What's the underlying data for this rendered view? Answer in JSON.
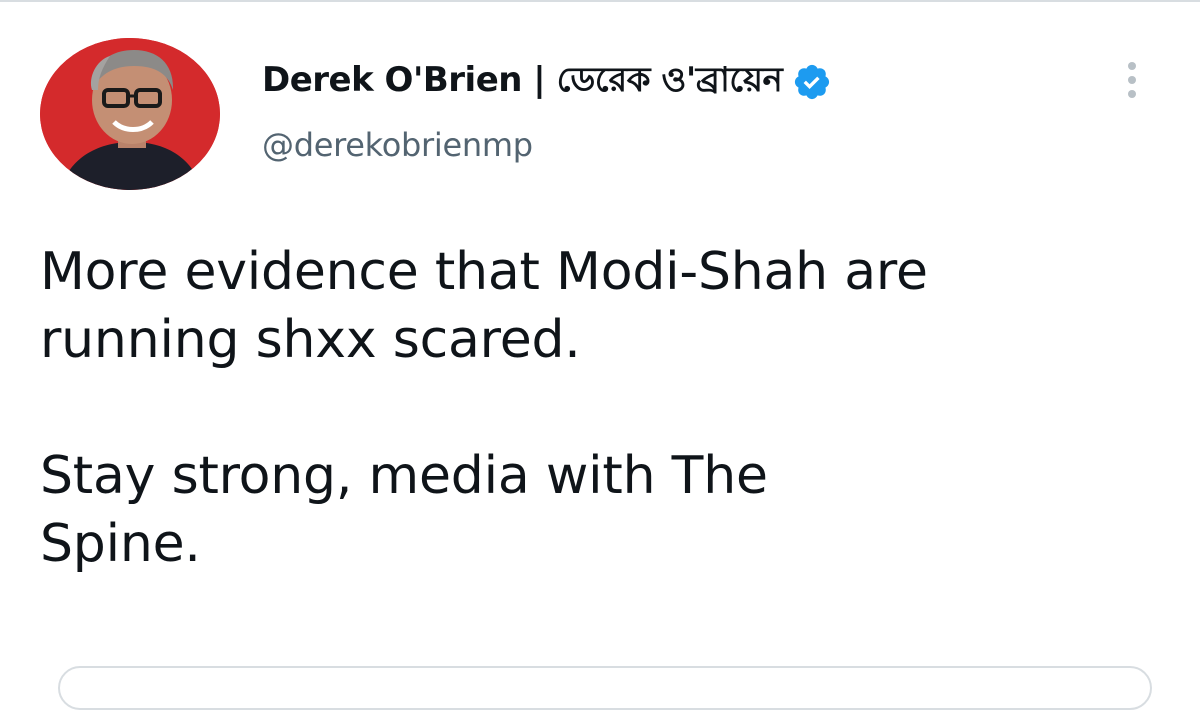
{
  "tweet": {
    "author": {
      "display_name": "Derek O'Brien | ডেরেক ও'ব্রায়েন",
      "handle": "@derekobrienmp",
      "verified": true,
      "avatar_background": "#d42a2c"
    },
    "text_lines": [
      "More evidence that Modi-Shah are",
      "running shxx scared.",
      "Stay strong, media with The",
      "Spine."
    ],
    "colors": {
      "text": "#0f1419",
      "secondary": "#536471",
      "verified": "#1d9bf0",
      "border": "#d8dde1"
    },
    "icons": {
      "verified": "verified-badge-icon",
      "more": "more-options-icon"
    }
  }
}
